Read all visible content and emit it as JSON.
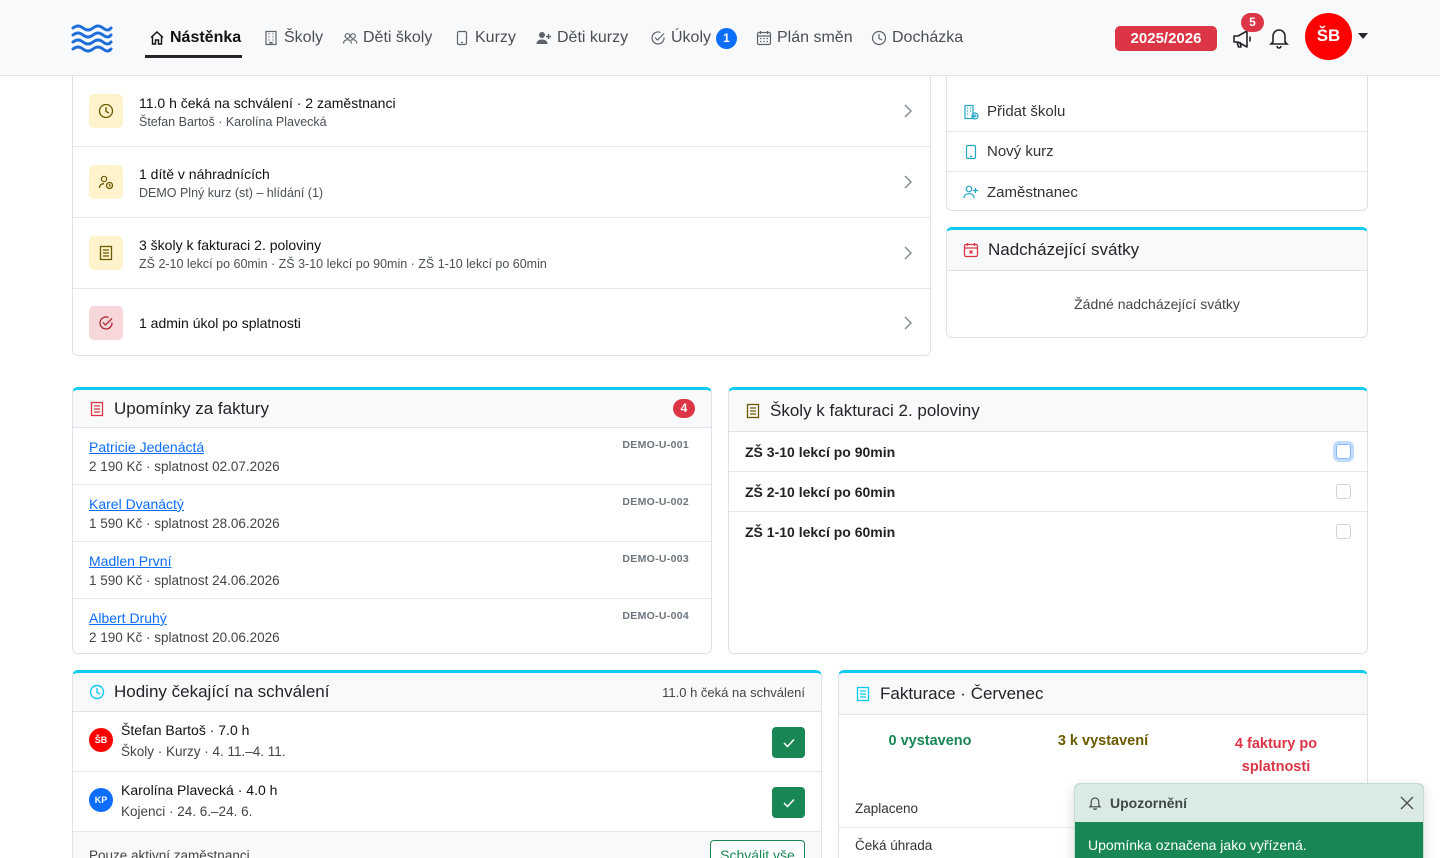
{
  "nav": {
    "items": [
      {
        "label": "Nástěnka",
        "icon": "home-icon"
      },
      {
        "label": "Školy",
        "icon": "building-icon"
      },
      {
        "label": "Děti školy",
        "icon": "people-icon"
      },
      {
        "label": "Kurzy",
        "icon": "tablet-icon"
      },
      {
        "label": "Děti kurzy",
        "icon": "person-plus-icon"
      },
      {
        "label": "Úkoly",
        "icon": "check-circle-icon",
        "badge": "1"
      },
      {
        "label": "Plán směn",
        "icon": "calendar-icon"
      },
      {
        "label": "Docházka",
        "icon": "clock-icon"
      }
    ],
    "school_year": "2025/2026",
    "announcements_count": "5",
    "user_initials": "ŠB"
  },
  "tasks": [
    {
      "title": "11.0 h čeká na schválení · 2 zaměstnanci",
      "subtitle": "Štefan Bartoš · Karolína Plavecká",
      "icon": "clock-icon",
      "color": "#fff3cd"
    },
    {
      "title": "1 dítě v náhradnících",
      "subtitle": "DEMO Plný kurz (st) – hlídání (1)",
      "icon": "person-wait-icon",
      "color": "#fff3cd"
    },
    {
      "title": "3 školy k fakturaci 2. poloviny",
      "subtitle": "ZŠ 2-10 lekcí po 60min · ZŠ 3-10 lekcí po 90min · ZŠ 1-10 lekcí po 60min",
      "icon": "receipt-icon",
      "color": "#fff3cd"
    },
    {
      "title": "1 admin úkol po splatnosti",
      "subtitle": "",
      "icon": "check-circle-icon",
      "color": "#f8d7da"
    }
  ],
  "quick_actions": [
    {
      "label": "Přidat školu",
      "icon": "building-add-icon"
    },
    {
      "label": "Nový kurz",
      "icon": "tablet-icon"
    },
    {
      "label": "Zaměstnanec",
      "icon": "person-plus-icon"
    }
  ],
  "holidays": {
    "title": "Nadcházející svátky",
    "empty": "Žádné nadcházející svátky"
  },
  "reminders": {
    "title": "Upomínky za faktury",
    "count": "4",
    "items": [
      {
        "name": "Patricie Jedenáctá",
        "detail": "2 190 Kč · splatnost 02.07.2026",
        "code": "DEMO-U-001"
      },
      {
        "name": "Karel Dvanáctý",
        "detail": "1 590 Kč · splatnost 28.06.2026",
        "code": "DEMO-U-002"
      },
      {
        "name": "Madlen První",
        "detail": "1 590 Kč · splatnost 24.06.2026",
        "code": "DEMO-U-003"
      },
      {
        "name": "Albert Druhý",
        "detail": "2 190 Kč · splatnost 20.06.2026",
        "code": "DEMO-U-004"
      }
    ]
  },
  "schools_invoice": {
    "title": "Školy k fakturaci 2. poloviny",
    "items": [
      "ZŠ 3-10 lekcí po 90min",
      "ZŠ 2-10 lekcí po 60min",
      "ZŠ 1-10 lekcí po 60min"
    ]
  },
  "hours": {
    "title": "Hodiny čekající na schválení",
    "summary": "11.0 h čeká na schválení",
    "items": [
      {
        "initials": "ŠB",
        "name": "Štefan Bartoš · 7.0 h",
        "detail": "Školy · Kurzy · 4. 11.–4. 11.",
        "color": "#ff0000"
      },
      {
        "initials": "KP",
        "name": "Karolína Plavecká · 4.0 h",
        "detail": "Kojenci · 24. 6.–24. 6.",
        "color": "#0d6efd"
      }
    ],
    "footer_text": "Pouze aktivní zaměstnanci",
    "approve_all": "Schválit vše"
  },
  "billing": {
    "title": "Fakturace · Červenec",
    "issued": "0 vystaveno",
    "to_issue": "3 k vystavení",
    "overdue": "4 faktury po splatnosti",
    "paid_label": "Zaplaceno",
    "pending_label": "Čeká úhrada",
    "colors": {
      "issued": "#198754",
      "to_issue": "#6b5a00",
      "overdue": "#dc3545"
    }
  },
  "toast": {
    "title": "Upozornění",
    "message": "Upomínka označena jako vyřízená."
  }
}
